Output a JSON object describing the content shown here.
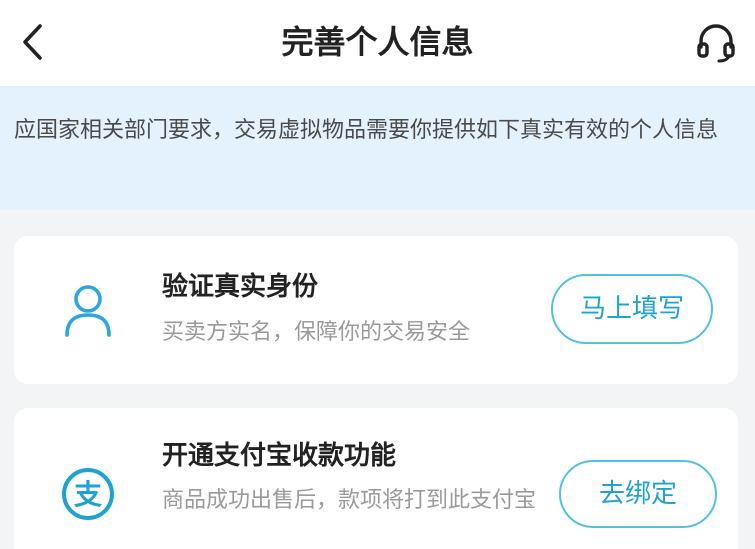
{
  "header": {
    "title": "完善个人信息",
    "back_icon": "chevron-left-icon",
    "service_icon": "headset-icon"
  },
  "notice": {
    "text": "应国家相关部门要求，交易虚拟物品需要你提供如下真实有效的个人信息"
  },
  "cards": [
    {
      "icon": "user-icon",
      "title": "验证真实身份",
      "description": "买卖方实名，保障你的交易安全",
      "button_label": "马上填写"
    },
    {
      "icon": "alipay-icon",
      "icon_glyph": "支",
      "title": "开通支付宝收款功能",
      "description": "商品成功出售后，款项将打到此支付宝",
      "button_label": "去绑定"
    }
  ],
  "colors": {
    "accent": "#1ea3d0",
    "button_border": "#4fc3e0",
    "notice_bg": "#e3f2fc",
    "page_bg": "#f3f4f6"
  }
}
